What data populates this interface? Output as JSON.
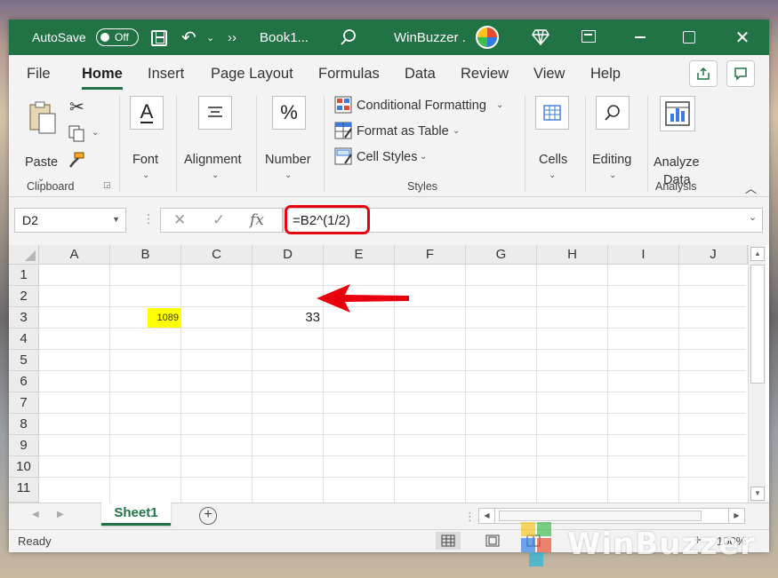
{
  "titlebar": {
    "autosave_label": "AutoSave",
    "autosave_state": "Off",
    "more_label": "››",
    "book_title": "Book1...",
    "user_name": "WinBuzzer ."
  },
  "tabs": [
    "File",
    "Home",
    "Insert",
    "Page Layout",
    "Formulas",
    "Data",
    "Review",
    "View",
    "Help"
  ],
  "active_tab": "Home",
  "ribbon": {
    "paste": "Paste",
    "clipboard": "Clipboard",
    "font": "Font",
    "alignment": "Alignment",
    "number": "Number",
    "conditional_formatting": "Conditional Formatting",
    "format_as_table": "Format as Table",
    "cell_styles": "Cell Styles",
    "styles": "Styles",
    "cells": "Cells",
    "editing": "Editing",
    "analyze_line1": "Analyze",
    "analyze_line2": "Data",
    "analysis": "Analysis",
    "percent_glyph": "%",
    "font_glyph": "A"
  },
  "formula_bar": {
    "name_box": "D2",
    "formula": "=B2^(1/2)",
    "fx_glyph": "fx"
  },
  "grid": {
    "columns": [
      "A",
      "B",
      "C",
      "D",
      "E",
      "F",
      "G",
      "H",
      "I",
      "J"
    ],
    "rows": [
      "1",
      "2",
      "3",
      "4",
      "5",
      "6",
      "7",
      "8",
      "9",
      "10",
      "11"
    ],
    "cells": {
      "B2": "1089",
      "D2": "33"
    },
    "highlight_color": "#ffff00"
  },
  "sheets": [
    "Sheet1"
  ],
  "add_sheet_glyph": "+",
  "status": {
    "ready": "Ready",
    "zoom_plus": "+",
    "zoom": "100%"
  },
  "watermark": {
    "text": "WinBuzzer"
  },
  "colors": {
    "accent": "#217346",
    "annotation": "#e8000d"
  }
}
